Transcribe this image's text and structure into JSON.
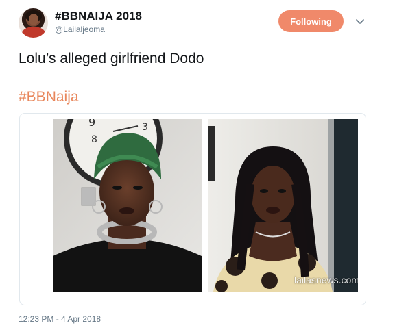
{
  "user": {
    "display_name": "#BBNAIJA 2018",
    "handle": "@Lailaljeoma"
  },
  "follow_button": {
    "label": "Following"
  },
  "tweet": {
    "text": "Lolu’s alleged girlfriend Dodo",
    "hashtag": "#BBNaija",
    "timestamp": "12:23 PM - 4 Apr 2018"
  },
  "media": {
    "watermark": "lailasnews.com"
  },
  "colors": {
    "accent": "#f0896a",
    "hashtag": "#e8875c",
    "muted": "#657786"
  },
  "icons": {
    "avatar": "profile-avatar",
    "menu": "chevron-down-icon"
  }
}
